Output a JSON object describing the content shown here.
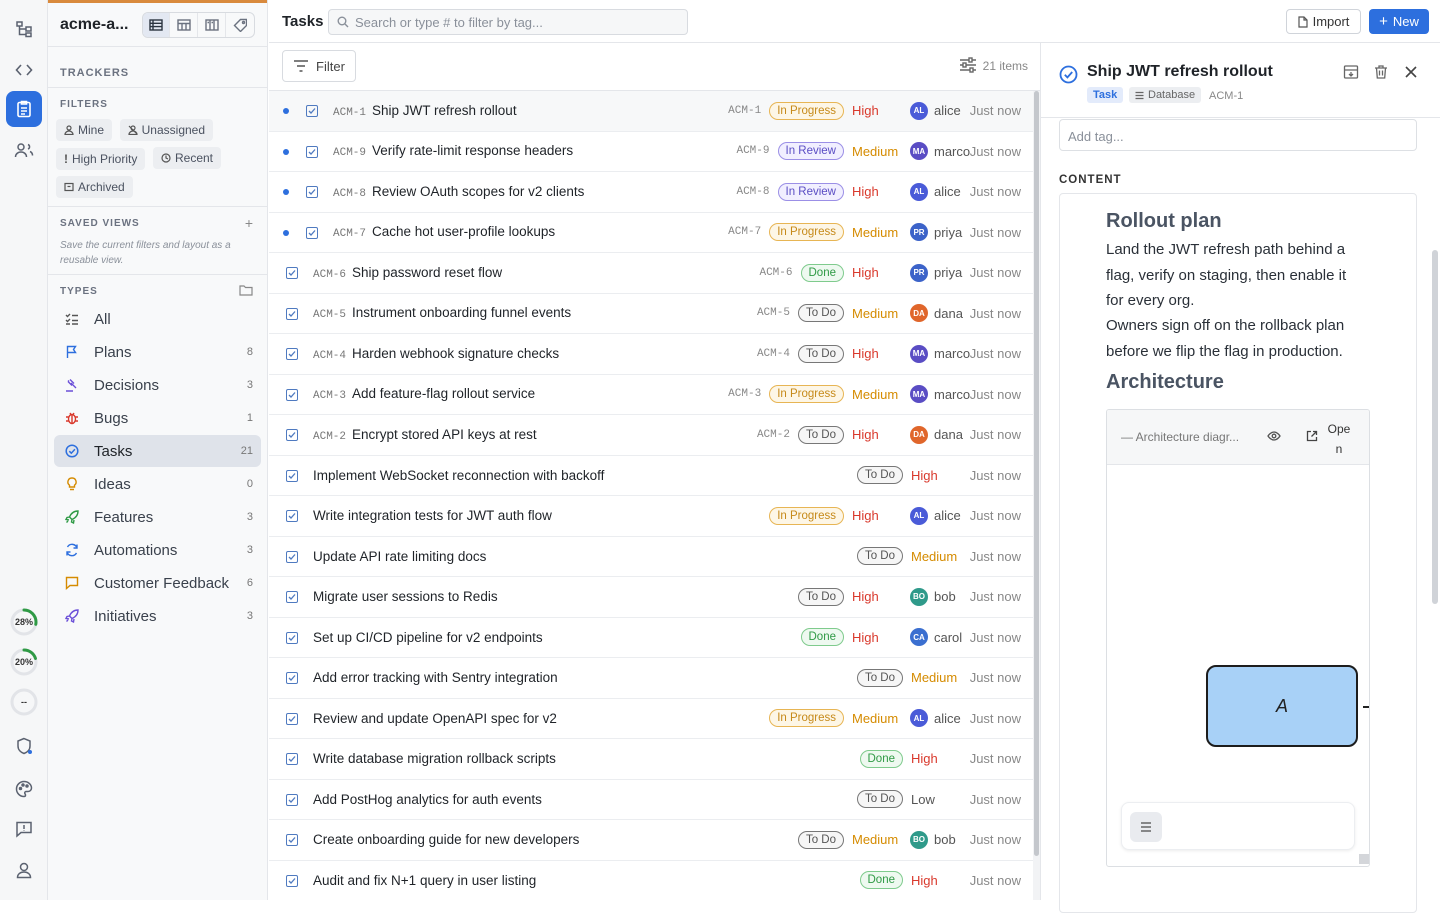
{
  "workspace": {
    "name": "acme-a..."
  },
  "sidebar": {
    "trackers_label": "TRACKERS",
    "filters_label": "FILTERS",
    "filters": [
      {
        "label": "Mine",
        "icon": "person-icon"
      },
      {
        "label": "Unassigned",
        "icon": "person-off-icon"
      },
      {
        "label": "High Priority",
        "icon": "exclamation-icon"
      },
      {
        "label": "Recent",
        "icon": "clock-icon"
      },
      {
        "label": "Archived",
        "icon": "archive-icon"
      }
    ],
    "saved_views_label": "SAVED VIEWS",
    "saved_views_hint": "Save the current filters and layout as a reusable view.",
    "types_label": "TYPES",
    "types": [
      {
        "label": "All",
        "count": "",
        "icon": "checklist-icon",
        "color": "#555555"
      },
      {
        "label": "Plans",
        "count": "8",
        "icon": "flag-icon",
        "color": "#2d6fde"
      },
      {
        "label": "Decisions",
        "count": "3",
        "icon": "gavel-icon",
        "color": "#6b4fd8"
      },
      {
        "label": "Bugs",
        "count": "1",
        "icon": "bug-icon",
        "color": "#d9392c"
      },
      {
        "label": "Tasks",
        "count": "21",
        "icon": "check-circle-icon",
        "color": "#2d6fde"
      },
      {
        "label": "Ideas",
        "count": "0",
        "icon": "lightbulb-icon",
        "color": "#d58b00"
      },
      {
        "label": "Features",
        "count": "3",
        "icon": "rocket-icon",
        "color": "#2f9a45"
      },
      {
        "label": "Automations",
        "count": "3",
        "icon": "refresh-icon",
        "color": "#2d6fde"
      },
      {
        "label": "Customer Feedback",
        "count": "6",
        "icon": "message-icon",
        "color": "#d58b00"
      },
      {
        "label": "Initiatives",
        "count": "3",
        "icon": "rocket-icon",
        "color": "#6b4fd8"
      }
    ]
  },
  "rail": {
    "gauges": [
      {
        "label": "28%",
        "value": 0.28
      },
      {
        "label": "20%",
        "value": 0.2
      },
      {
        "label": "--",
        "value": 0
      }
    ]
  },
  "header": {
    "title": "Tasks",
    "search_placeholder": "Search or type # to filter by tag...",
    "import_label": "Import",
    "new_label": "New"
  },
  "toolbar": {
    "filter_label": "Filter",
    "items_count": "21 items"
  },
  "colors": {
    "accent": "#2d6fde"
  },
  "tasks": [
    {
      "id": "ACM-1",
      "title": "Ship JWT refresh rollout",
      "status": "In Progress",
      "priority": "High",
      "user": "alice",
      "initials": "AL",
      "time": "Just now",
      "unread": true
    },
    {
      "id": "ACM-9",
      "title": "Verify rate-limit response headers",
      "status": "In Review",
      "priority": "Medium",
      "user": "marco",
      "initials": "MA",
      "time": "Just now",
      "unread": true
    },
    {
      "id": "ACM-8",
      "title": "Review OAuth scopes for v2 clients",
      "status": "In Review",
      "priority": "High",
      "user": "alice",
      "initials": "AL",
      "time": "Just now",
      "unread": true
    },
    {
      "id": "ACM-7",
      "title": "Cache hot user-profile lookups",
      "status": "In Progress",
      "priority": "Medium",
      "user": "priya",
      "initials": "PR",
      "time": "Just now",
      "unread": true
    },
    {
      "id": "ACM-6",
      "title": "Ship password reset flow",
      "status": "Done",
      "priority": "High",
      "user": "priya",
      "initials": "PR",
      "time": "Just now",
      "unread": false
    },
    {
      "id": "ACM-5",
      "title": "Instrument onboarding funnel events",
      "status": "To Do",
      "priority": "Medium",
      "user": "dana",
      "initials": "DA",
      "time": "Just now",
      "unread": false
    },
    {
      "id": "ACM-4",
      "title": "Harden webhook signature checks",
      "status": "To Do",
      "priority": "High",
      "user": "marco",
      "initials": "MA",
      "time": "Just now",
      "unread": false
    },
    {
      "id": "ACM-3",
      "title": "Add feature-flag rollout service",
      "status": "In Progress",
      "priority": "Medium",
      "user": "marco",
      "initials": "MA",
      "time": "Just now",
      "unread": false
    },
    {
      "id": "ACM-2",
      "title": "Encrypt stored API keys at rest",
      "status": "To Do",
      "priority": "High",
      "user": "dana",
      "initials": "DA",
      "time": "Just now",
      "unread": false
    },
    {
      "id": "",
      "title": "Implement WebSocket reconnection with backoff",
      "status": "To Do",
      "priority": "High",
      "user": "",
      "initials": "",
      "time": "Just now",
      "unread": false
    },
    {
      "id": "",
      "title": "Write integration tests for JWT auth flow",
      "status": "In Progress",
      "priority": "High",
      "user": "alice",
      "initials": "AL",
      "time": "Just now",
      "unread": false
    },
    {
      "id": "",
      "title": "Update API rate limiting docs",
      "status": "To Do",
      "priority": "Medium",
      "user": "",
      "initials": "",
      "time": "Just now",
      "unread": false
    },
    {
      "id": "",
      "title": "Migrate user sessions to Redis",
      "status": "To Do",
      "priority": "High",
      "user": "bob",
      "initials": "BO",
      "time": "Just now",
      "unread": false
    },
    {
      "id": "",
      "title": "Set up CI/CD pipeline for v2 endpoints",
      "status": "Done",
      "priority": "High",
      "user": "carol",
      "initials": "CA",
      "time": "Just now",
      "unread": false
    },
    {
      "id": "",
      "title": "Add error tracking with Sentry integration",
      "status": "To Do",
      "priority": "Medium",
      "user": "",
      "initials": "",
      "time": "Just now",
      "unread": false
    },
    {
      "id": "",
      "title": "Review and update OpenAPI spec for v2",
      "status": "In Progress",
      "priority": "Medium",
      "user": "alice",
      "initials": "AL",
      "time": "Just now",
      "unread": false
    },
    {
      "id": "",
      "title": "Write database migration rollback scripts",
      "status": "Done",
      "priority": "High",
      "user": "",
      "initials": "",
      "time": "Just now",
      "unread": false
    },
    {
      "id": "",
      "title": "Add PostHog analytics for auth events",
      "status": "To Do",
      "priority": "Low",
      "user": "",
      "initials": "",
      "time": "Just now",
      "unread": false
    },
    {
      "id": "",
      "title": "Create onboarding guide for new developers",
      "status": "To Do",
      "priority": "Medium",
      "user": "bob",
      "initials": "BO",
      "time": "Just now",
      "unread": false
    },
    {
      "id": "",
      "title": "Audit and fix N+1 query in user listing",
      "status": "Done",
      "priority": "High",
      "user": "",
      "initials": "",
      "time": "Just now",
      "unread": false
    }
  ],
  "user_colors": {
    "alice": "#4a5bd8",
    "marco": "#5a4dc4",
    "priya": "#3c63c9",
    "dana": "#e0662b",
    "bob": "#2f9a8a",
    "carol": "#3b6fd0"
  },
  "detail": {
    "title": "Ship JWT refresh rollout",
    "type_tag": "Task",
    "area_tag": "Database",
    "id": "ACM-1",
    "add_tag_placeholder": "Add tag...",
    "content_label": "CONTENT",
    "doc": {
      "h1": "Rollout plan",
      "p1": "Land the JWT refresh path behind a flag, verify on staging, then enable it for every org.",
      "p2": "Owners sign off on the rollback plan before we flip the flag in production.",
      "h2": "Architecture",
      "embed_title": "— Architecture diagr...",
      "embed_open": "Ope n",
      "node_label": "A"
    }
  }
}
